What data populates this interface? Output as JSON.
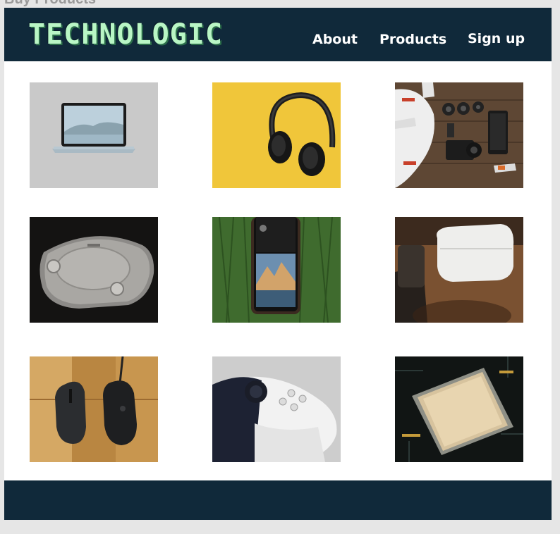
{
  "page": {
    "title": "Buy Products"
  },
  "header": {
    "logo": "TECHNOLOGIC",
    "nav": [
      {
        "label": "About"
      },
      {
        "label": "Products"
      },
      {
        "label": "Sign up"
      }
    ]
  },
  "products": [
    {
      "icon": "laptop-icon"
    },
    {
      "icon": "headphones-icon"
    },
    {
      "icon": "drone-camera-icon"
    },
    {
      "icon": "game-console-icon"
    },
    {
      "icon": "smartphone-icon"
    },
    {
      "icon": "earbuds-case-icon"
    },
    {
      "icon": "mouse-icon"
    },
    {
      "icon": "gamepad-icon"
    },
    {
      "icon": "cpu-chip-icon"
    }
  ],
  "colors": {
    "header_bg": "#10293a",
    "logo": "#b9f6c5",
    "nav_text": "#ffffff",
    "page_bg": "#e6e6e6"
  }
}
